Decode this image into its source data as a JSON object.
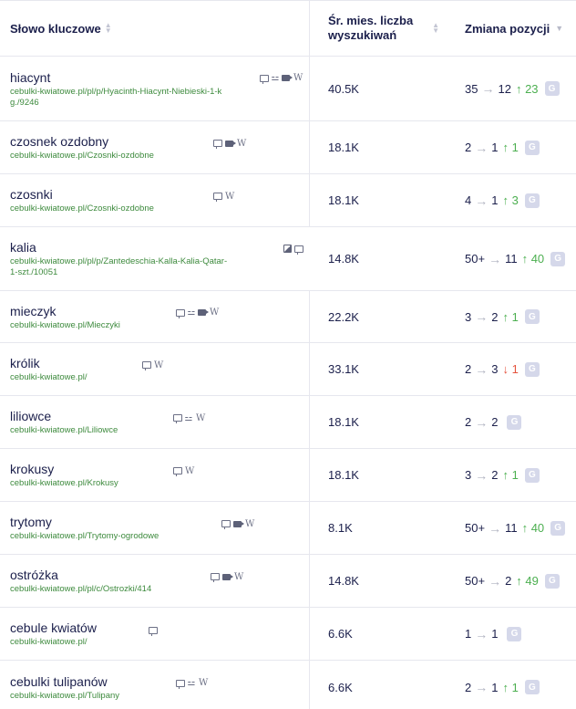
{
  "header": {
    "keyword": "Słowo kluczowe",
    "volume": "Śr. mies. liczba wyszukiwań",
    "position": "Zmiana pozycji"
  },
  "rows": [
    {
      "keyword": "hiacynt",
      "url": "cebulki-kwiatowe.pl/pl/p/Hyacinth-Hiacynt-Niebieski-1-kg./9246",
      "volume": "40.5K",
      "from": "35",
      "to": "12",
      "delta": "23",
      "dir": "up"
    },
    {
      "keyword": "czosnek ozdobny",
      "url": "cebulki-kwiatowe.pl/Czosnki-ozdobne",
      "volume": "18.1K",
      "from": "2",
      "to": "1",
      "delta": "1",
      "dir": "up"
    },
    {
      "keyword": "czosnki",
      "url": "cebulki-kwiatowe.pl/Czosnki-ozdobne",
      "volume": "18.1K",
      "from": "4",
      "to": "1",
      "delta": "3",
      "dir": "up"
    },
    {
      "keyword": "kalia",
      "url": "cebulki-kwiatowe.pl/pl/p/Zantedeschia-Kalla-Kalia-Qatar-1-szt./10051",
      "volume": "14.8K",
      "from": "50+",
      "to": "11",
      "delta": "40",
      "dir": "up"
    },
    {
      "keyword": "mieczyk",
      "url": "cebulki-kwiatowe.pl/Mieczyki",
      "volume": "22.2K",
      "from": "3",
      "to": "2",
      "delta": "1",
      "dir": "up"
    },
    {
      "keyword": "królik",
      "url": "cebulki-kwiatowe.pl/",
      "volume": "33.1K",
      "from": "2",
      "to": "3",
      "delta": "1",
      "dir": "down"
    },
    {
      "keyword": "liliowce",
      "url": "cebulki-kwiatowe.pl/Liliowce",
      "volume": "18.1K",
      "from": "2",
      "to": "2",
      "delta": "",
      "dir": "none"
    },
    {
      "keyword": "krokusy",
      "url": "cebulki-kwiatowe.pl/Krokusy",
      "volume": "18.1K",
      "from": "3",
      "to": "2",
      "delta": "1",
      "dir": "up"
    },
    {
      "keyword": "trytomy",
      "url": "cebulki-kwiatowe.pl/Trytomy-ogrodowe",
      "volume": "8.1K",
      "from": "50+",
      "to": "11",
      "delta": "40",
      "dir": "up"
    },
    {
      "keyword": "ostróżka",
      "url": "cebulki-kwiatowe.pl/pl/c/Ostrozki/414",
      "volume": "14.8K",
      "from": "50+",
      "to": "2",
      "delta": "49",
      "dir": "up"
    },
    {
      "keyword": "cebule kwiatów",
      "url": "cebulki-kwiatowe.pl/",
      "volume": "6.6K",
      "from": "1",
      "to": "1",
      "delta": "",
      "dir": "none"
    },
    {
      "keyword": "cebulki tulipanów",
      "url": "cebulki-kwiatowe.pl/Tulipany",
      "volume": "6.6K",
      "from": "2",
      "to": "1",
      "delta": "1",
      "dir": "up"
    }
  ],
  "badge": "G",
  "icons": {
    "arrow": "→",
    "up": "↑",
    "down": "↓",
    "wiki": "W",
    "sitelinks": "𐂂",
    "sort": "sort-icon",
    "chevron": "chevron-down-icon"
  },
  "colors": {
    "delta_up": "#4caf50",
    "delta_down": "#e5533d",
    "url": "#3d8a3d",
    "badge": "#d5d8ea"
  }
}
